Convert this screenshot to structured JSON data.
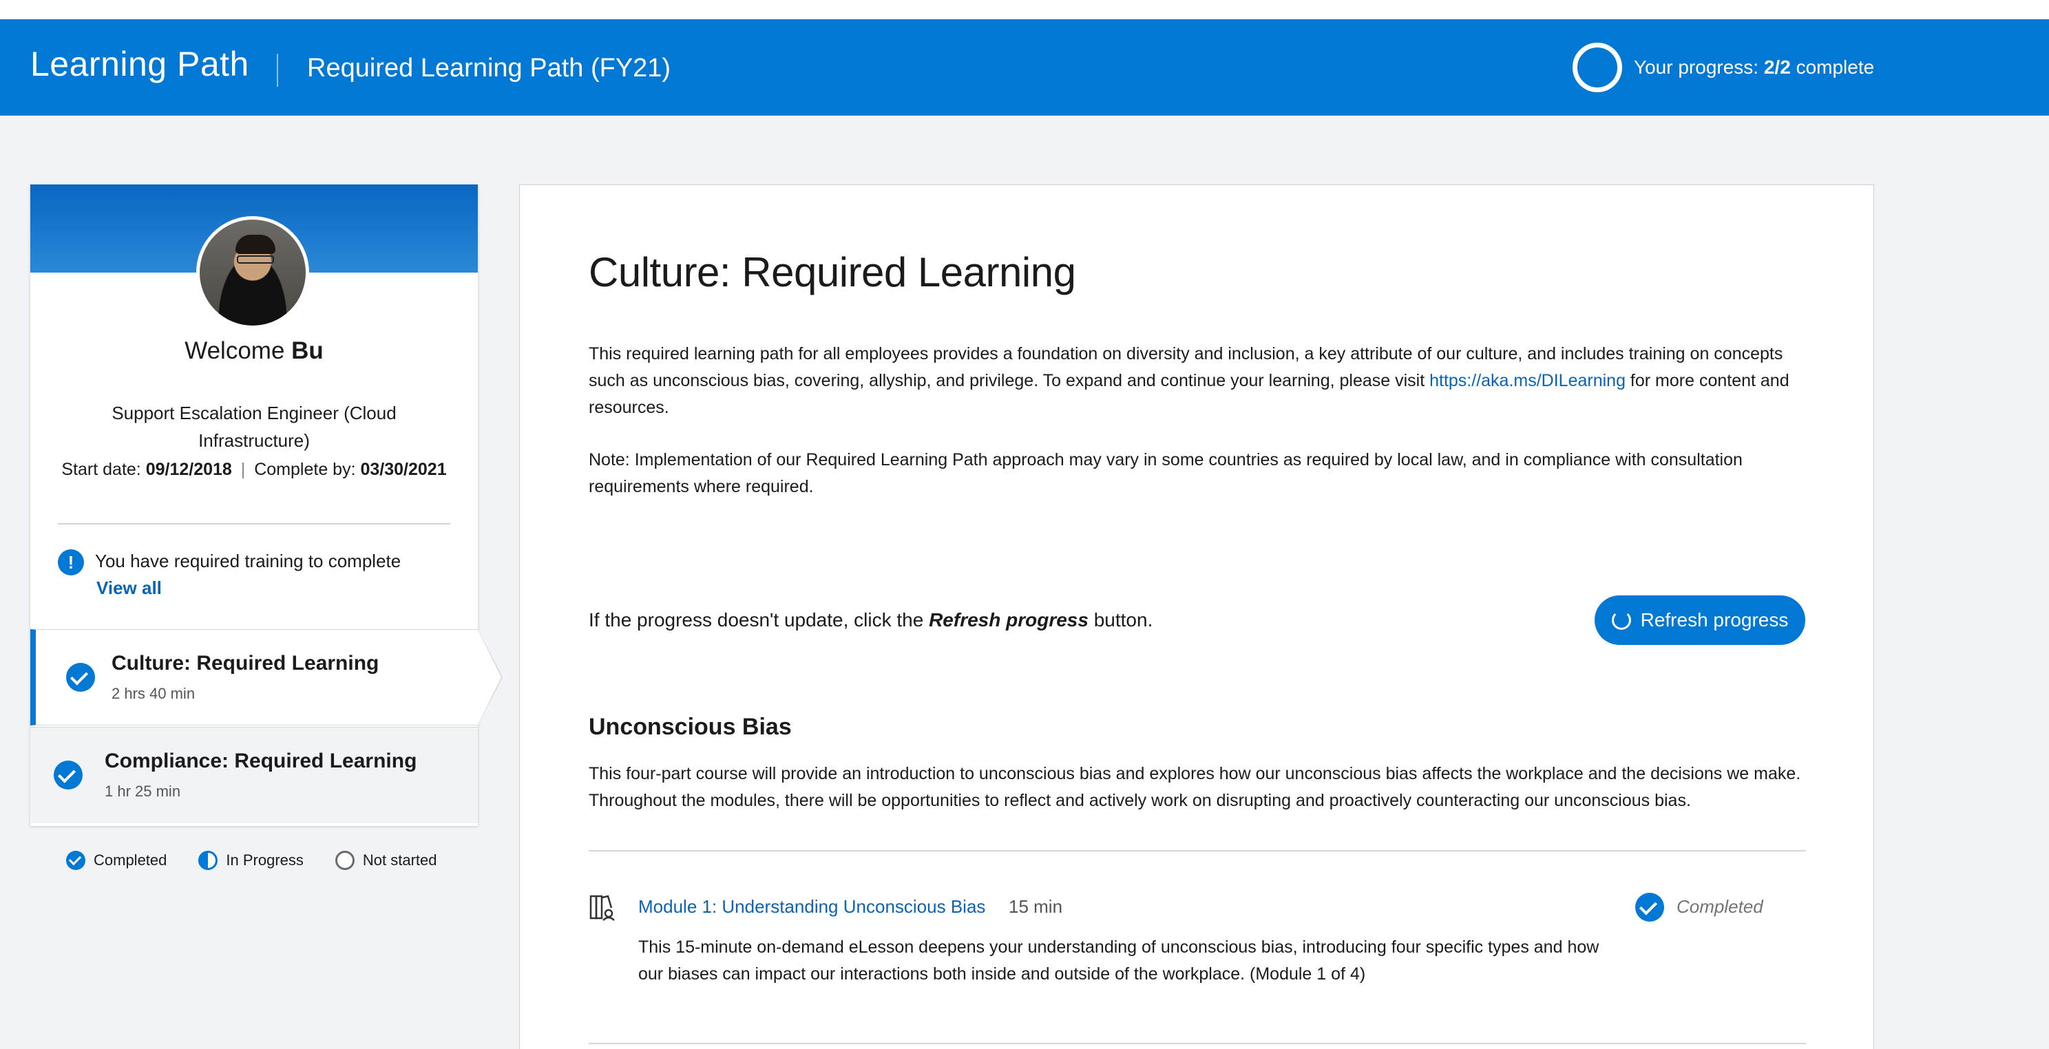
{
  "header": {
    "app_title": "Learning Path",
    "path_title": "Required Learning Path (FY21)",
    "progress_label": "Your progress:",
    "progress_value": "2/2",
    "progress_suffix": "complete"
  },
  "profile": {
    "welcome": "Welcome",
    "name": "Bu",
    "job_title": "Support Escalation Engineer (Cloud Infrastructure)",
    "start_label": "Start date:",
    "start_date": "09/12/2018",
    "separator": "|",
    "complete_label": "Complete by:",
    "complete_date": "03/30/2021",
    "alert_icon": "!",
    "alert_text": "You have required training to complete",
    "view_all": "View all"
  },
  "paths": [
    {
      "title": "Culture: Required Learning",
      "duration": "2 hrs 40 min",
      "status": "completed",
      "active": true
    },
    {
      "title": "Compliance: Required Learning",
      "duration": "1 hr 25 min",
      "status": "completed",
      "active": false
    }
  ],
  "legend": {
    "completed": "Completed",
    "in_progress": "In Progress",
    "not_started": "Not started"
  },
  "main": {
    "title": "Culture: Required Learning",
    "description_before_link": "This required learning path for all employees provides a foundation on diversity and inclusion, a key attribute of our culture, and includes training on concepts such as unconscious bias, covering, allyship, and privilege. To expand and continue your learning, please visit ",
    "description_link": "https://aka.ms/DILearning",
    "description_after_link": " for more content and resources.",
    "note": "Note: Implementation of our Required Learning Path approach may vary in some countries as required by local law, and in compliance with consultation requirements where required.",
    "refresh_note_before": "If the progress doesn't update, click the ",
    "refresh_note_bold": "Refresh progress",
    "refresh_note_after": " button.",
    "refresh_button": "Refresh progress",
    "section_title": "Unconscious Bias",
    "section_description": "This four-part course will provide an introduction to unconscious bias and explores how our unconscious bias affects the workplace and the decisions we make. Throughout the modules, there will be opportunities to reflect and actively work on disrupting and proactively counteracting our unconscious bias.",
    "module": {
      "title": "Module 1: Understanding Unconscious Bias",
      "duration": "15 min",
      "status": "Completed",
      "description": "This 15-minute on-demand eLesson deepens your understanding of unconscious bias, introducing four specific types and how our biases can impact our interactions both inside and outside of the workplace. (Module 1 of 4)"
    }
  },
  "colors": {
    "brand": "#0078d4",
    "link": "#0b63b7",
    "page_bg": "#f1f3f6"
  }
}
